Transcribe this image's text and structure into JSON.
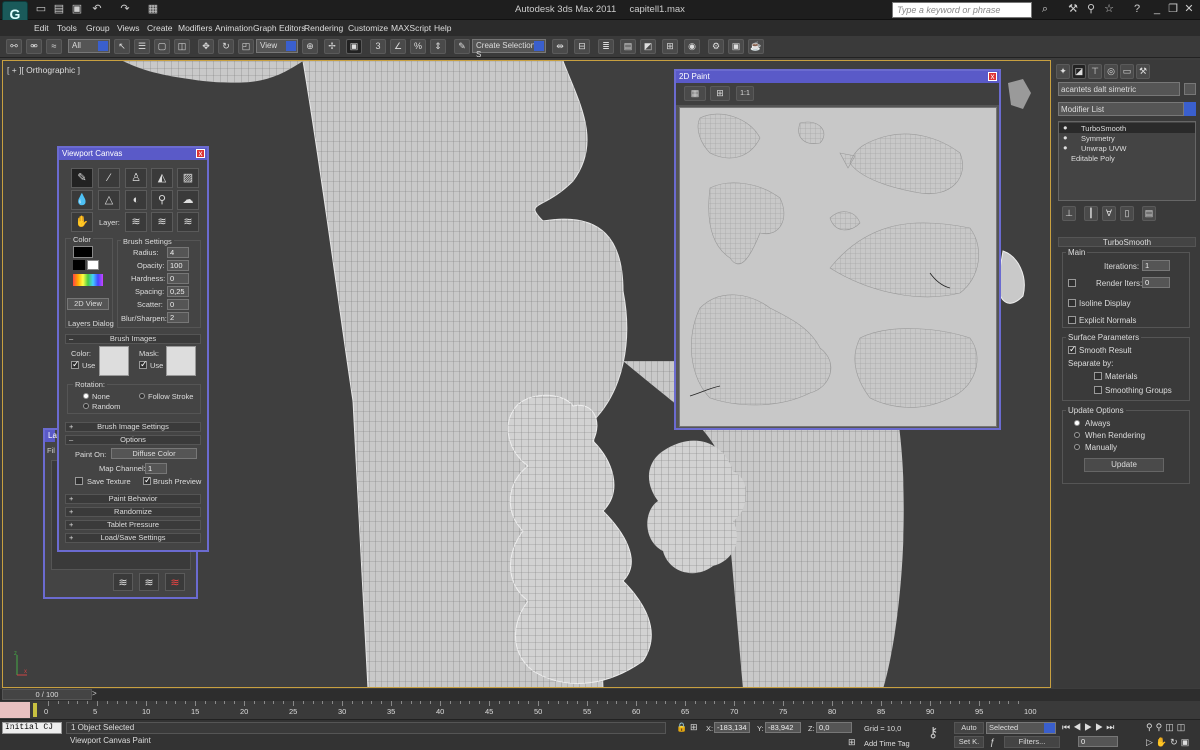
{
  "window": {
    "app_title": "Autodesk 3ds Max  2011",
    "file_title": "capitell1.max",
    "search_placeholder": "Type a keyword or phrase"
  },
  "menu": [
    "Edit",
    "Tools",
    "Group",
    "Views",
    "Create",
    "Modifiers",
    "Animation",
    "Graph Editors",
    "Rendering",
    "Customize",
    "MAXScript",
    "Help"
  ],
  "toolbar": {
    "selection_filter": "All",
    "ref_coord": "View",
    "named_selection": "Create Selection S",
    "snap_value": "3"
  },
  "viewport": {
    "label": "[ + ][ Orthographic ]"
  },
  "command_panel": {
    "object_name": "acantets dalt simetric",
    "modifier_list_label": "Modifier List",
    "stack": [
      "TurboSmooth",
      "Symmetry",
      "Unwrap UVW",
      "Editable Poly"
    ],
    "rollout_title": "TurboSmooth",
    "main_group": "Main",
    "iterations_label": "Iterations:",
    "iterations_value": "1",
    "render_iters_label": "Render Iters:",
    "render_iters_value": "0",
    "isoline_label": "Isoline Display",
    "explicit_normals_label": "Explicit Normals",
    "surface_group": "Surface Parameters",
    "smooth_result_label": "Smooth Result",
    "separate_by_label": "Separate by:",
    "materials_label": "Materials",
    "smoothing_groups_label": "Smoothing Groups",
    "update_options_group": "Update Options",
    "always_label": "Always",
    "when_rendering_label": "When Rendering",
    "manually_label": "Manually",
    "update_button": "Update"
  },
  "paint2d": {
    "title": "2D Paint",
    "btn_fit": "1:1"
  },
  "viewport_canvas": {
    "title": "Viewport Canvas",
    "layer_label": "Layer:",
    "color_group": "Color",
    "brush_settings_group": "Brush Settings",
    "radius_label": "Radius:",
    "radius_value": "4",
    "opacity_label": "Opacity:",
    "opacity_value": "100",
    "hardness_label": "Hardness:",
    "hardness_value": "0",
    "spacing_label": "Spacing:",
    "spacing_value": "0,25",
    "scatter_label": "Scatter:",
    "scatter_value": "0",
    "blur_label": "Blur/Sharpen:",
    "blur_value": "2",
    "view2d_button": "2D View",
    "layers_dialog": "Layers Dialog",
    "brush_images_title": "Brush Images",
    "color_label": "Color:",
    "mask_label": "Mask:",
    "use_label": "Use",
    "rotation_label": "Rotation:",
    "none_label": "None",
    "follow_stroke_label": "Follow Stroke",
    "random_label": "Random",
    "brush_image_settings": "Brush Image Settings",
    "options_title": "Options",
    "paint_on_label": "Paint On:",
    "paint_on_value": "Diffuse Color",
    "map_channel_label": "Map Channel:",
    "map_channel_value": "1",
    "save_texture_label": "Save Texture",
    "brush_preview_label": "Brush Preview",
    "paint_behavior": "Paint Behavior",
    "randomize": "Randomize",
    "tablet_pressure": "Tablet Pressure",
    "load_save": "Load/Save Settings"
  },
  "layers_panel": {
    "title": "Lay",
    "tab": "Fil"
  },
  "timeline": {
    "frame_display": "0 / 100",
    "ticks": [
      "0",
      "5",
      "10",
      "15",
      "20",
      "25",
      "30",
      "35",
      "40",
      "45",
      "50",
      "55",
      "60",
      "65",
      "70",
      "75",
      "80",
      "85",
      "90",
      "95",
      "100"
    ]
  },
  "status": {
    "selection_info": "1 Object Selected",
    "prompt": "Viewport Canvas Paint",
    "maxscript": "Initial CJ",
    "x_label": "X:",
    "x_value": "-183,134",
    "y_label": "Y:",
    "y_value": "-83,942",
    "z_label": "Z:",
    "z_value": "0,0",
    "grid": "Grid = 10,0",
    "add_time_tag": "Add Time Tag",
    "auto_key": "Auto",
    "set_key": "Set K.",
    "key_filter": "Selected",
    "filters": "Filters...",
    "current_frame": "0"
  }
}
